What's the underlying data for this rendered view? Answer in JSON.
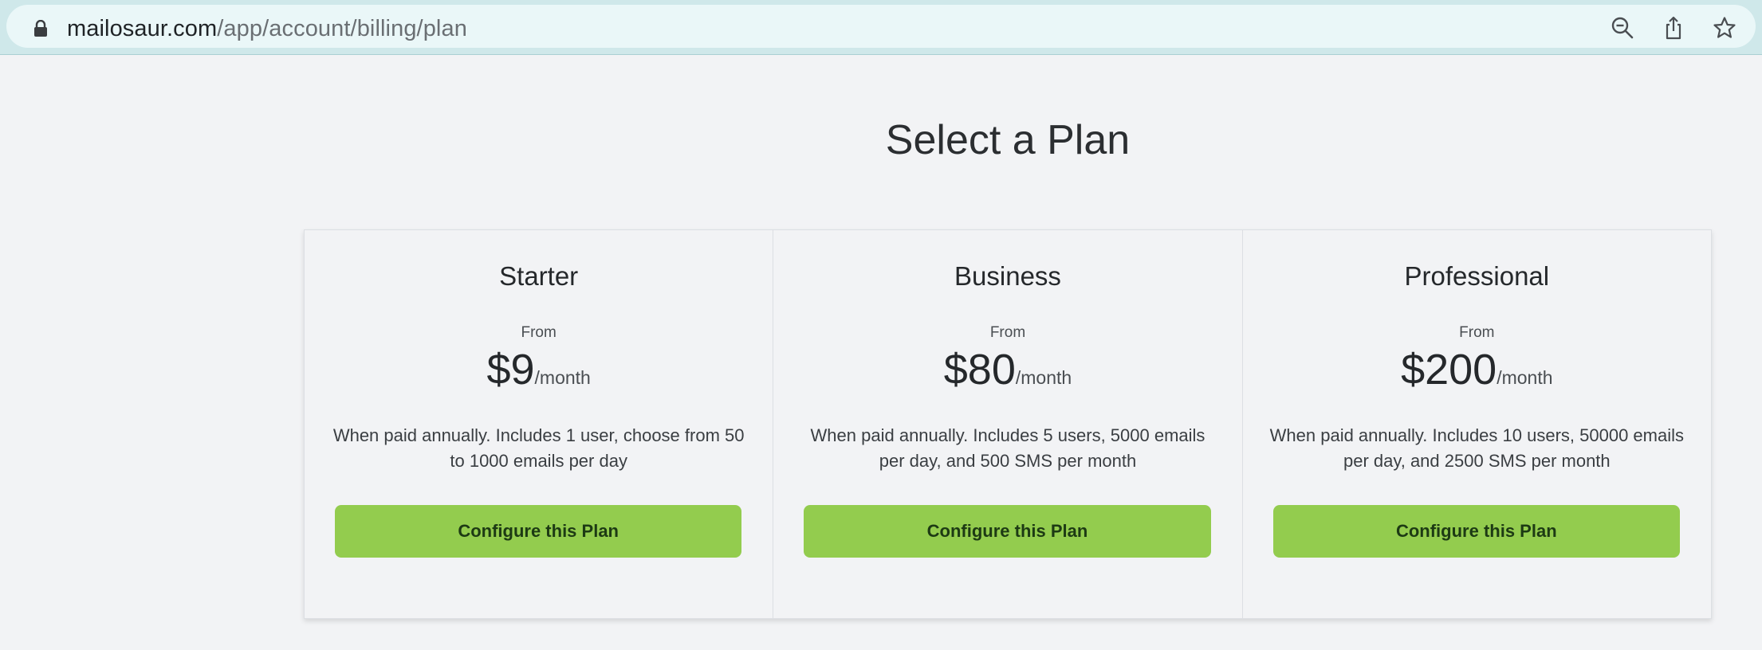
{
  "browser": {
    "url_domain": "mailosaur.com",
    "url_path": "/app/account/billing/plan",
    "icons": [
      "lock-icon",
      "zoom-out-icon",
      "share-icon",
      "bookmark-star-icon"
    ]
  },
  "page": {
    "title": "Select a Plan"
  },
  "plans": [
    {
      "name": "Starter",
      "from_label": "From",
      "price": "$9",
      "period": "/month",
      "description": "When paid annually. Includes 1 user, choose from 50 to 1000 emails per day",
      "button_label": "Configure this Plan"
    },
    {
      "name": "Business",
      "from_label": "From",
      "price": "$80",
      "period": "/month",
      "description": "When paid annually. Includes 5 users, 5000 emails per day, and 500 SMS per month",
      "button_label": "Configure this Plan"
    },
    {
      "name": "Professional",
      "from_label": "From",
      "price": "$200",
      "period": "/month",
      "description": "When paid annually. Includes 10 users, 50000 emails per day, and 2500 SMS per month",
      "button_label": "Configure this Plan"
    }
  ],
  "colors": {
    "button_background": "#93cc4e",
    "button_text": "#1d3a14",
    "page_background": "#f2f3f5",
    "browser_bar": "#cfe8ea"
  }
}
